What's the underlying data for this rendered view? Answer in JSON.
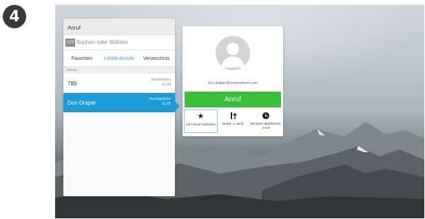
{
  "step_number": "4",
  "call_panel": {
    "title": "Anruf",
    "search": {
      "keypad_label": "123",
      "placeholder": "Suchen oder Wählen"
    },
    "tabs": [
      {
        "label": "Favoriten",
        "active": false
      },
      {
        "label": "Letzte Anrufe",
        "active": true
      },
      {
        "label": "Verzeichnis",
        "active": false
      }
    ],
    "section_header": "Heute",
    "entries": [
      {
        "name": "789",
        "status": "Empfangen",
        "time": "11:28",
        "selected": false
      },
      {
        "name": "Don Draper",
        "status": "Durchgeführt",
        "time": "11:28",
        "selected": true
      }
    ]
  },
  "contact_card": {
    "email": "don.draper@somewhere.com",
    "call_button_label": "Anruf",
    "actions": [
      {
        "icon": "star-icon",
        "label": "Als Favorit markieren",
        "highlighted": true
      },
      {
        "icon": "edit-call-icon",
        "label": "Bearb. u. anruf.",
        "highlighted": false
      },
      {
        "icon": "clock-icon",
        "label": "Benutzer-spezifischer Anruf",
        "highlighted": false
      }
    ]
  },
  "colors": {
    "accent_blue": "#1d9bd6",
    "call_green": "#3bbf3b"
  }
}
